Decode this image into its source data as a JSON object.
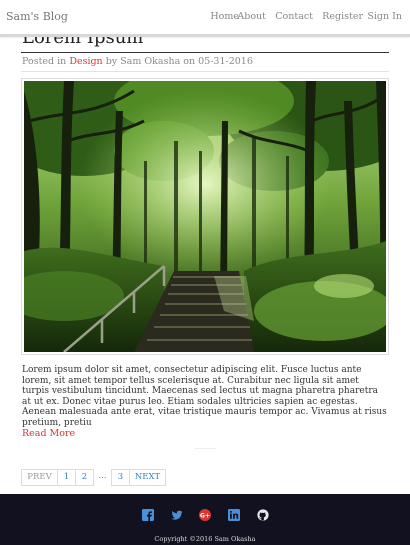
{
  "navbar": {
    "brand": "Sam's Blog",
    "links": [
      "Home",
      "About",
      "Contact",
      "Register",
      "Sign In"
    ]
  },
  "post": {
    "title": "Lorem Ipsum",
    "meta_prefix": "Posted in ",
    "category": "Design",
    "meta_suffix": " by Sam Okasha on 05-31-2016",
    "image_alt": "forest-staircase-photo",
    "excerpt": "Lorem ipsum dolor sit amet, consectetur adipiscing elit. Fusce luctus ante lorem, sit amet tempor tellus scelerisque at. Curabitur nec ligula sit amet turpis vestibulum tincidunt. Maecenas sed lectus ut magna pharetra pharetra at ut ex. Donec vitae purus leo. Etiam sodales ultricies sapien ac egestas. Aenean malesuada ante erat, vitae tristique mauris tempor ac. Vivamus at risus pretium, pretiu",
    "read_more": "Read More"
  },
  "pagination": {
    "prev": "PREV",
    "pages": [
      "1",
      "2"
    ],
    "gap": "...",
    "last": "3",
    "next": "NEXT"
  },
  "footer": {
    "social_icons": [
      "facebook-icon",
      "twitter-icon",
      "google-plus-icon",
      "linkedin-icon",
      "github-icon"
    ],
    "copyright": "Copyright ©2016 Sam Okasha"
  },
  "colors": {
    "accent": "#d9362f",
    "link": "#3a7fc1",
    "footer_bg": "#11111f",
    "social_icon": "#4a90d9"
  }
}
